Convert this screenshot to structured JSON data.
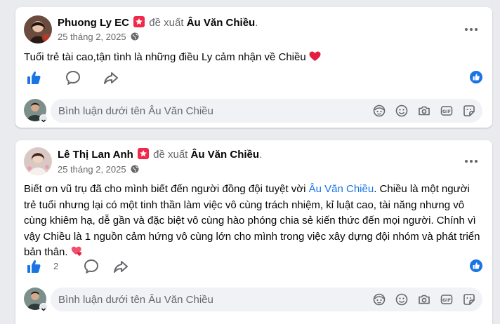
{
  "posts": [
    {
      "author": "Phuong Ly EC",
      "verb": "đề xuất",
      "target": "Âu Văn Chiều",
      "date": "25 tháng 2, 2025",
      "text": "Tuổi trẻ tài cao,tận tình là những điều Ly cảm nhận về Chiều",
      "like_count": "",
      "comment_placeholder": "Bình luận dưới tên Âu Văn Chiều"
    },
    {
      "author": "Lê Thị Lan Anh",
      "verb": "đề xuất",
      "target": "Âu Văn Chiều",
      "date": "25 tháng 2, 2025",
      "text_before": "Biết ơn vũ trụ đã cho mình biết đến người đồng đội tuyệt vời ",
      "mention": "Âu Văn Chiều",
      "text_after": ". Chiều là một người trẻ tuổi nhưng lại có một tinh thần làm việc vô cùng trách nhiệm, kỉ luật cao, tài năng nhưng vô cùng khiêm hạ, dễ gần và đặc biệt vô cùng hào phóng chia sẻ kiến thức đến mọi người. Chính vì vậy Chiều là 1 nguồn cảm hứng vô cùng lớn cho mình trong việc xây dựng đội nhóm và phát triển bản thân.",
      "like_count": "2",
      "comment_placeholder": "Bình luận dưới tên Âu Văn Chiều"
    }
  ],
  "colors": {
    "accent": "#1b74e4",
    "heart": "#e41e3f",
    "badge": "#f02849",
    "secondary_text": "#65676b"
  },
  "icons": {
    "badge": "recommendation-star-badge-icon",
    "globe": "globe-icon",
    "more": "more-dots-icon",
    "like": "thumbs-up-icon",
    "comment": "comment-bubble-icon",
    "share": "share-arrow-icon",
    "comment_icons": [
      "avatar-sticker-icon",
      "emoji-icon",
      "camera-icon",
      "gif-icon",
      "sticker-icon"
    ]
  }
}
